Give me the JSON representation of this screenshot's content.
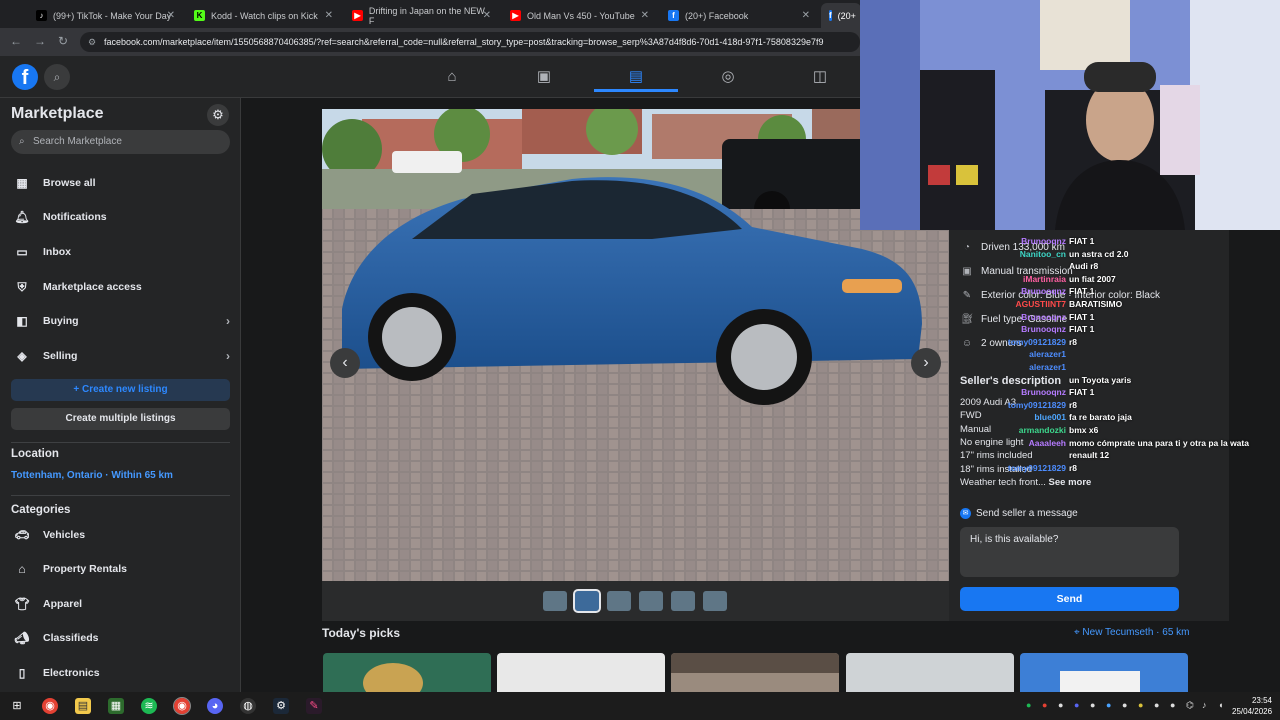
{
  "browser": {
    "tabs": [
      {
        "label": "(99+) TikTok - Make Your Day",
        "icon": "tiktok-icon"
      },
      {
        "label": "Kodd - Watch clips on Kick",
        "icon": "kick-icon"
      },
      {
        "label": "Drifting in Japan on the NEW F",
        "icon": "youtube-icon"
      },
      {
        "label": "Old Man Vs 450 - YouTube",
        "icon": "youtube-icon"
      },
      {
        "label": "(20+) Facebook",
        "icon": "facebook-icon"
      },
      {
        "label": "(20+",
        "icon": "facebook-icon"
      }
    ],
    "url": "facebook.com/marketplace/item/1550568870406385/?ref=search&referral_code=null&referral_story_type=post&tracking=browse_serp%3A87d4f8d6-70d1-418d-97f1-75808329e7f9"
  },
  "sidebar": {
    "title": "Marketplace",
    "search_placeholder": "Search Marketplace",
    "items": [
      {
        "label": "Browse all",
        "icon": "storefront-icon"
      },
      {
        "label": "Notifications",
        "icon": "bell-icon"
      },
      {
        "label": "Inbox",
        "icon": "inbox-icon"
      },
      {
        "label": "Marketplace access",
        "icon": "shield-icon"
      },
      {
        "label": "Buying",
        "icon": "shopping-bag-icon"
      },
      {
        "label": "Selling",
        "icon": "tag-icon"
      }
    ],
    "create_listing": "+ Create new listing",
    "create_multiple": "Create multiple listings",
    "location_heading": "Location",
    "location_value": "Tottenham, Ontario · Within 65 km",
    "categories_heading": "Categories",
    "categories": [
      {
        "label": "Vehicles",
        "icon": "car-icon"
      },
      {
        "label": "Property Rentals",
        "icon": "house-icon"
      },
      {
        "label": "Apparel",
        "icon": "shirt-icon"
      },
      {
        "label": "Classifieds",
        "icon": "megaphone-icon"
      },
      {
        "label": "Electronics",
        "icon": "phone-icon"
      }
    ]
  },
  "details": {
    "rows": [
      {
        "text": "Driven 133,000 km",
        "icon": "speedometer-icon"
      },
      {
        "text": "Manual transmission",
        "icon": "gearbox-icon"
      },
      {
        "text": "Exterior color: Blue · Interior color: Black",
        "icon": "paint-icon"
      },
      {
        "text": "Fuel type: Gasoline",
        "icon": "fuel-icon"
      },
      {
        "text": "2 owners",
        "icon": "person-icon"
      }
    ],
    "seller_heading": "Seller's description",
    "description": [
      "2009 Audi A3",
      "FWD",
      "Manual",
      "No engine light",
      "17\" rims included",
      "18\" rims installed"
    ],
    "description_tail": "Weather tech front...",
    "see_more": "See more",
    "message_heading": "Send seller a message",
    "message_value": "Hi, is this available?",
    "send_label": "Send"
  },
  "chat": [
    {
      "user": "Brunooqnz",
      "msg": "FIAT 1",
      "color": "#b57bff"
    },
    {
      "user": "Nanitoo_cn",
      "msg": "un astra cd 2.0",
      "color": "#3dd6c6"
    },
    {
      "user": "",
      "msg": "Audi r8",
      "color": "#7aa9ff"
    },
    {
      "user": "iMartinraia",
      "msg": "un fiat 2007",
      "color": "#ff5fa2"
    },
    {
      "user": "Brunooqnz",
      "msg": "FIAT 1",
      "color": "#b57bff"
    },
    {
      "user": "AGUSTIINT7",
      "msg": "BARATISIMO",
      "color": "#ff4a4a"
    },
    {
      "user": "Brunooqnz",
      "msg": "FIAT 1",
      "color": "#b57bff"
    },
    {
      "user": "Brunooqnz",
      "msg": "FIAT 1",
      "color": "#b57bff"
    },
    {
      "user": "tomy09121829",
      "msg": "r8",
      "color": "#4d8dff"
    },
    {
      "user": "alerazer1",
      "msg": "",
      "color": "#4d8dff"
    },
    {
      "user": "alerazer1",
      "msg": "",
      "color": "#4d8dff"
    },
    {
      "user": "",
      "msg": "un Toyota yaris",
      "color": "#4d8dff"
    },
    {
      "user": "Brunooqnz",
      "msg": "FIAT 1",
      "color": "#b57bff"
    },
    {
      "user": "tomy09121829",
      "msg": "r8",
      "color": "#4d8dff"
    },
    {
      "user": "blue001",
      "msg": "fa re barato jaja",
      "color": "#4da6ff"
    },
    {
      "user": "armandozki",
      "msg": "bmx x6",
      "color": "#3dd68c"
    },
    {
      "user": "Aaaaleeh",
      "msg": "momo cómprate una para ti y otra pa la wata",
      "color": "#b57bff"
    },
    {
      "user": "",
      "msg": "renault 12",
      "color": "#ff5fa2"
    },
    {
      "user": "tomy09121829",
      "msg": "r8",
      "color": "#4d8dff"
    }
  ],
  "picks": {
    "title": "Today's picks",
    "location": "New Tecumseth · 65 km"
  },
  "taskbar": {
    "time": "23:54",
    "date": "25/04/2026"
  },
  "colors": {
    "accent": "#1877f2",
    "link": "#4599ff",
    "bg": "#18191a",
    "surface": "#242526"
  }
}
